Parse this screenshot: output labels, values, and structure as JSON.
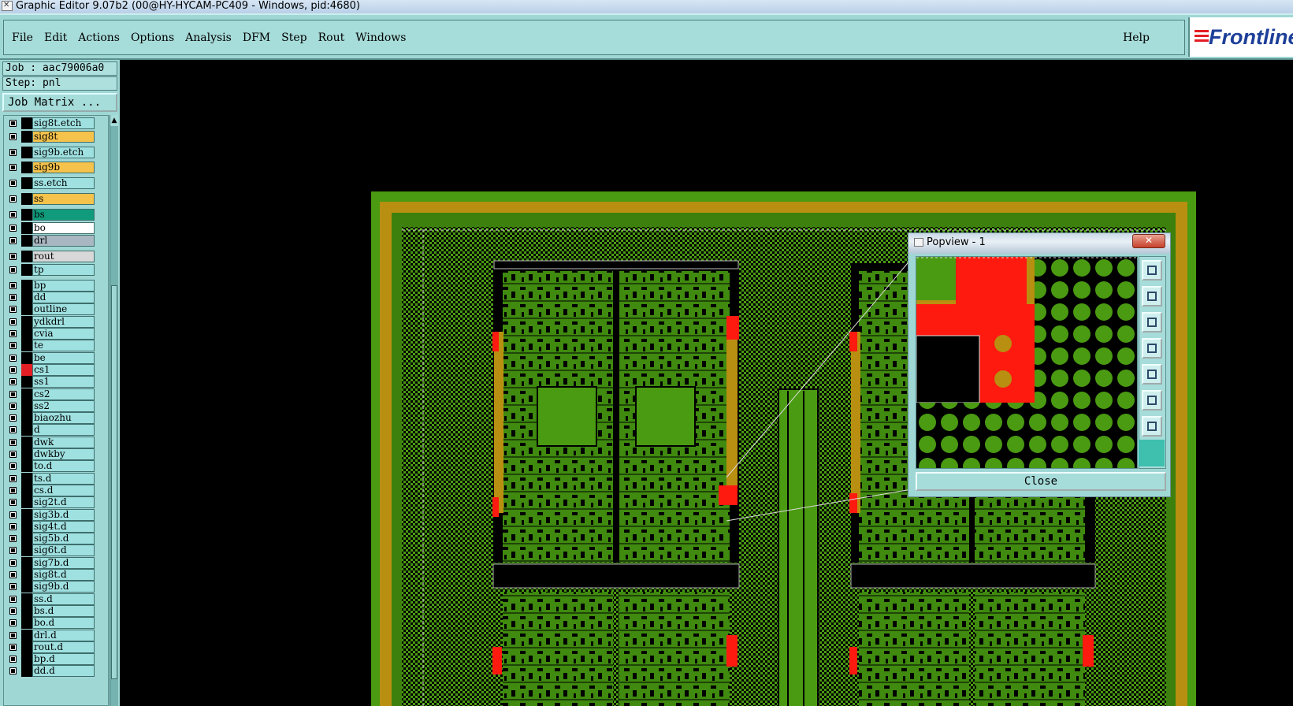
{
  "window": {
    "title": "Graphic Editor 9.07b2 (00@HY-HYCAM-PC409 - Windows, pid:4680)"
  },
  "menu": {
    "items": [
      "File",
      "Edit",
      "Actions",
      "Options",
      "Analysis",
      "DFM",
      "Step",
      "Rout",
      "Windows"
    ],
    "help": "Help",
    "logo": "Frontline"
  },
  "job": {
    "job_label": "Job : aac79006a0",
    "step_label": "Step: pnl",
    "matrix_button": "Job Matrix ..."
  },
  "layers": [
    {
      "name": "sig8t.etch",
      "color": "#9fe0e0",
      "swatch": "#000000"
    },
    {
      "name": "sig8t",
      "color": "#f5c24b",
      "swatch": "#000000"
    },
    {
      "name": "sig9b.etch",
      "color": "#9fe0e0",
      "swatch": "#000000"
    },
    {
      "name": "sig9b",
      "color": "#f5c24b",
      "swatch": "#000000"
    },
    {
      "name": "ss.etch",
      "color": "#9fe0e0",
      "swatch": "#000000"
    },
    {
      "name": "ss",
      "color": "#f5c24b",
      "swatch": "#000000"
    },
    {
      "name": "bs",
      "color": "#109c7c",
      "swatch": "#000000"
    },
    {
      "name": "bo",
      "color": "#ffffff",
      "swatch": "#000000"
    },
    {
      "name": "drl",
      "color": "#a9b7c2",
      "swatch": "#000000"
    },
    {
      "name": "rout",
      "color": "#d8d8d8",
      "swatch": "#000000"
    },
    {
      "name": "tp",
      "color": "#9fe0e0",
      "swatch": "#000000"
    },
    {
      "name": "bp",
      "color": "#9fe0e0",
      "swatch": "#000000"
    },
    {
      "name": "dd",
      "color": "#9fe0e0",
      "swatch": "#000000"
    },
    {
      "name": "outline",
      "color": "#9fe0e0",
      "swatch": "#000000"
    },
    {
      "name": "ydkdrl",
      "color": "#9fe0e0",
      "swatch": "#000000"
    },
    {
      "name": "cvia",
      "color": "#9fe0e0",
      "swatch": "#000000"
    },
    {
      "name": "te",
      "color": "#9fe0e0",
      "swatch": "#000000"
    },
    {
      "name": "be",
      "color": "#9fe0e0",
      "swatch": "#000000"
    },
    {
      "name": "cs1",
      "color": "#9fe0e0",
      "swatch": "#e31e24"
    },
    {
      "name": "ss1",
      "color": "#9fe0e0",
      "swatch": "#000000"
    },
    {
      "name": "cs2",
      "color": "#9fe0e0",
      "swatch": "#000000"
    },
    {
      "name": "ss2",
      "color": "#9fe0e0",
      "swatch": "#000000"
    },
    {
      "name": "biaozhu",
      "color": "#9fe0e0",
      "swatch": "#000000"
    },
    {
      "name": "d",
      "color": "#9fe0e0",
      "swatch": "#000000"
    },
    {
      "name": "dwk",
      "color": "#9fe0e0",
      "swatch": "#000000"
    },
    {
      "name": "dwkby",
      "color": "#9fe0e0",
      "swatch": "#000000"
    },
    {
      "name": "to.d",
      "color": "#9fe0e0",
      "swatch": "#000000"
    },
    {
      "name": "ts.d",
      "color": "#9fe0e0",
      "swatch": "#000000"
    },
    {
      "name": "cs.d",
      "color": "#9fe0e0",
      "swatch": "#000000"
    },
    {
      "name": "sig2t.d",
      "color": "#9fe0e0",
      "swatch": "#000000"
    },
    {
      "name": "sig3b.d",
      "color": "#9fe0e0",
      "swatch": "#000000"
    },
    {
      "name": "sig4t.d",
      "color": "#9fe0e0",
      "swatch": "#000000"
    },
    {
      "name": "sig5b.d",
      "color": "#9fe0e0",
      "swatch": "#000000"
    },
    {
      "name": "sig6t.d",
      "color": "#9fe0e0",
      "swatch": "#000000"
    },
    {
      "name": "sig7b.d",
      "color": "#9fe0e0",
      "swatch": "#000000"
    },
    {
      "name": "sig8t.d",
      "color": "#9fe0e0",
      "swatch": "#000000"
    },
    {
      "name": "sig9b.d",
      "color": "#9fe0e0",
      "swatch": "#000000"
    },
    {
      "name": "ss.d",
      "color": "#9fe0e0",
      "swatch": "#000000"
    },
    {
      "name": "bs.d",
      "color": "#9fe0e0",
      "swatch": "#000000"
    },
    {
      "name": "bo.d",
      "color": "#9fe0e0",
      "swatch": "#000000"
    },
    {
      "name": "drl.d",
      "color": "#9fe0e0",
      "swatch": "#000000"
    },
    {
      "name": "rout.d",
      "color": "#9fe0e0",
      "swatch": "#000000"
    },
    {
      "name": "bp.d",
      "color": "#9fe0e0",
      "swatch": "#000000"
    },
    {
      "name": "dd.d",
      "color": "#9fe0e0",
      "swatch": "#000000"
    }
  ],
  "popview": {
    "title": "Popview - 1",
    "close_x": "✕",
    "close_button": "Close"
  },
  "colors": {
    "board_green": "#4a9a12",
    "copper_gold": "#b88f10",
    "pad_red": "#ff1a10",
    "ui_teal": "#9fd7d5"
  }
}
